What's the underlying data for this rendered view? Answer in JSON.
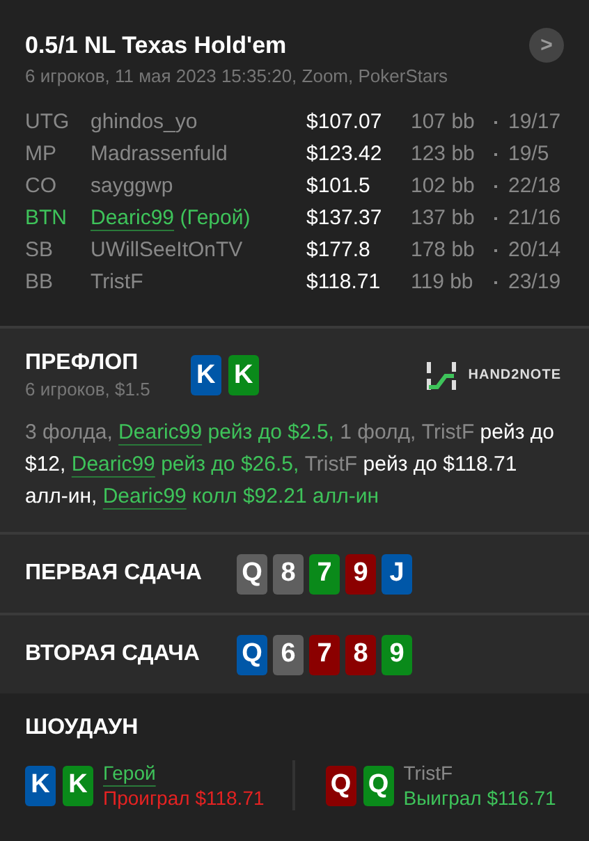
{
  "header": {
    "title": "0.5/1 NL Texas Hold'em",
    "subtitle": "6 игроков, 11 мая 2023 15:35:20, Zoom, PokerStars",
    "next_button": ">"
  },
  "players": [
    {
      "position": "UTG",
      "name": "ghindos_yo",
      "hero": false,
      "stack": "$107.07",
      "bb": "107 bb",
      "stats": "19/17"
    },
    {
      "position": "MP",
      "name": "Madrassenfuld",
      "hero": false,
      "stack": "$123.42",
      "bb": "123 bb",
      "stats": "19/5"
    },
    {
      "position": "CO",
      "name": "sayggwp",
      "hero": false,
      "stack": "$101.5",
      "bb": "102 bb",
      "stats": "22/18"
    },
    {
      "position": "BTN",
      "name": "Dearic99",
      "hero_tag": "(Герой)",
      "hero": true,
      "stack": "$137.37",
      "bb": "137 bb",
      "stats": "21/16"
    },
    {
      "position": "SB",
      "name": "UWillSeeItOnTV",
      "hero": false,
      "stack": "$177.8",
      "bb": "178 bb",
      "stats": "20/14"
    },
    {
      "position": "BB",
      "name": "TristF",
      "hero": false,
      "stack": "$118.71",
      "bb": "119 bb",
      "stats": "23/19"
    }
  ],
  "preflop": {
    "title": "ПРЕФЛОП",
    "subtitle": "6 игроков, $1.5",
    "hero_cards": [
      {
        "rank": "K",
        "color": "#0057a8"
      },
      {
        "rank": "K",
        "color": "#0a8a1a"
      }
    ],
    "logo": "HAND2NOTE",
    "actions": [
      {
        "kind": "muted",
        "text": "3 фолда, "
      },
      {
        "kind": "hero_link",
        "text": "Dearic99"
      },
      {
        "kind": "hero",
        "text": " рейз до $2.5,"
      },
      {
        "kind": "muted",
        "text": " 1 фолд, TristF"
      },
      {
        "kind": "plain",
        "text": " рейз до $12, "
      },
      {
        "kind": "hero_link",
        "text": "Dearic99"
      },
      {
        "kind": "hero",
        "text": " рейз до $26.5,"
      },
      {
        "kind": "muted",
        "text": " TristF"
      },
      {
        "kind": "plain",
        "text": " рейз до $118.71 алл-ин, "
      },
      {
        "kind": "hero_link",
        "text": "Dearic99"
      },
      {
        "kind": "hero",
        "text": " колл $92.21 алл-ин"
      }
    ]
  },
  "boards": [
    {
      "title": "ПЕРВАЯ СДАЧА",
      "cards": [
        {
          "rank": "Q",
          "color": "#5f5f5f"
        },
        {
          "rank": "8",
          "color": "#5f5f5f"
        },
        {
          "rank": "7",
          "color": "#0a8a1a"
        },
        {
          "rank": "9",
          "color": "#8b0000"
        },
        {
          "rank": "J",
          "color": "#0057a8"
        }
      ]
    },
    {
      "title": "ВТОРАЯ СДАЧА",
      "cards": [
        {
          "rank": "Q",
          "color": "#0057a8"
        },
        {
          "rank": "6",
          "color": "#5f5f5f"
        },
        {
          "rank": "7",
          "color": "#8b0000"
        },
        {
          "rank": "8",
          "color": "#8b0000"
        },
        {
          "rank": "9",
          "color": "#0a8a1a"
        }
      ]
    }
  ],
  "showdown": {
    "title": "ШОУДАУН",
    "hands": [
      {
        "name": "Герой",
        "hero": true,
        "won": false,
        "result": "Проиграл $118.71",
        "cards": [
          {
            "rank": "K",
            "color": "#0057a8"
          },
          {
            "rank": "K",
            "color": "#0a8a1a"
          }
        ]
      },
      {
        "name": "TristF",
        "hero": false,
        "won": true,
        "result": "Выиграл $116.71",
        "cards": [
          {
            "rank": "Q",
            "color": "#8b0000"
          },
          {
            "rank": "Q",
            "color": "#0a8a1a"
          }
        ]
      }
    ]
  }
}
